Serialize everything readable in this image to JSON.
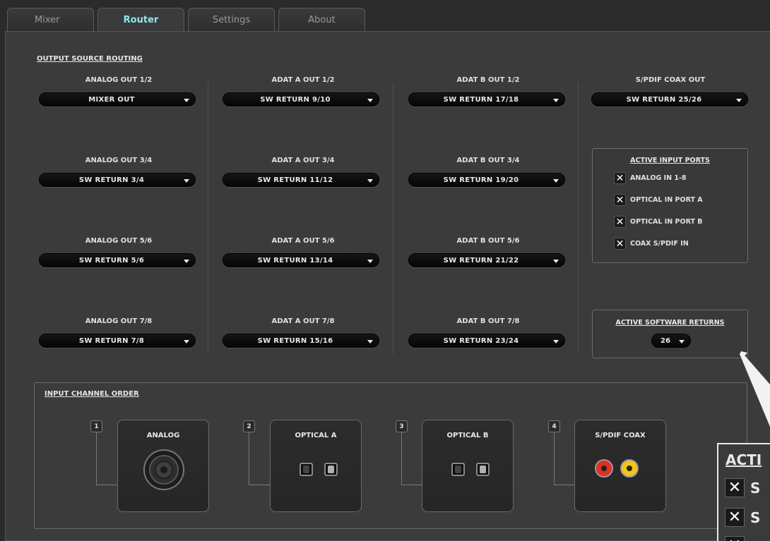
{
  "tabs": [
    {
      "label": "Mixer"
    },
    {
      "label": "Router"
    },
    {
      "label": "Settings"
    },
    {
      "label": "About"
    }
  ],
  "routing": {
    "title": "OUTPUT SOURCE ROUTING",
    "outputs": [
      {
        "label": "ANALOG OUT 1/2",
        "value": "MIXER OUT"
      },
      {
        "label": "ADAT A OUT 1/2",
        "value": "SW RETURN 9/10"
      },
      {
        "label": "ADAT B OUT 1/2",
        "value": "SW RETURN 17/18"
      },
      {
        "label": "S/PDIF COAX OUT",
        "value": "SW RETURN 25/26"
      },
      {
        "label": "ANALOG OUT 3/4",
        "value": "SW RETURN 3/4"
      },
      {
        "label": "ADAT A OUT 3/4",
        "value": "SW RETURN 11/12"
      },
      {
        "label": "ADAT B OUT 3/4",
        "value": "SW RETURN 19/20"
      },
      {
        "label": "ANALOG OUT 5/6",
        "value": "SW RETURN 5/6"
      },
      {
        "label": "ADAT A OUT 5/6",
        "value": "SW RETURN 13/14"
      },
      {
        "label": "ADAT B OUT 5/6",
        "value": "SW RETURN 21/22"
      },
      {
        "label": "ANALOG OUT 7/8",
        "value": "SW RETURN 7/8"
      },
      {
        "label": "ADAT A OUT 7/8",
        "value": "SW RETURN 15/16"
      },
      {
        "label": "ADAT B OUT 7/8",
        "value": "SW RETURN 23/24"
      }
    ]
  },
  "active_inputs": {
    "title": "ACTIVE INPUT PORTS",
    "ports": [
      {
        "label": "ANALOG IN 1-8",
        "check": "✕"
      },
      {
        "label": "OPTICAL IN PORT A",
        "check": "✕"
      },
      {
        "label": "OPTICAL IN PORT B",
        "check": "✕"
      },
      {
        "label": "COAX S/PDIF IN",
        "check": "✕"
      }
    ]
  },
  "active_returns": {
    "title": "ACTIVE SOFTWARE RETURNS",
    "value": "26"
  },
  "input_order": {
    "title": "INPUT CHANNEL ORDER",
    "cards": [
      {
        "num": "1",
        "title": "ANALOG"
      },
      {
        "num": "2",
        "title": "OPTICAL A"
      },
      {
        "num": "3",
        "title": "OPTICAL B"
      },
      {
        "num": "4",
        "title": "S/PDIF COAX"
      }
    ]
  },
  "zoom": {
    "title": "ACTI",
    "rows": [
      {
        "check": "✕",
        "letter": "S"
      },
      {
        "check": "✕",
        "letter": "S"
      },
      {
        "check": "✕",
        "letter": ""
      }
    ]
  },
  "colors": {
    "active_tab": "#8ee8ee",
    "rca_red": "#e0301e",
    "rca_yellow": "#f5c518"
  }
}
